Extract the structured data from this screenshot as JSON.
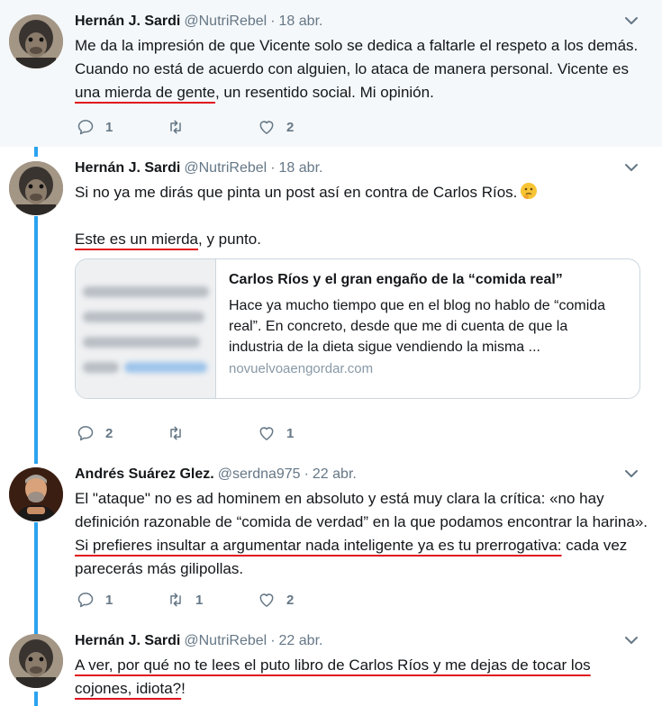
{
  "tweets": [
    {
      "name": "Hernán J. Sardi",
      "handle": "@NutriRebel",
      "date": "18 abr.",
      "text": {
        "p1": "Me da la impresión de que Vicente solo se dedica a faltarle el respeto a los demás. Cuando no está de acuerdo con alguien, lo ataca de manera personal. Vicente es ",
        "u1": "una mierda de gente",
        "p2": ", un resentido social. Mi opinión."
      },
      "actions": {
        "replies": "1",
        "retweets": "",
        "likes": "2"
      }
    },
    {
      "name": "Hernán J. Sardi",
      "handle": "@NutriRebel",
      "date": "18 abr.",
      "text": {
        "line1": "Si no ya me dirás que pinta un post así en contra de Carlos Ríos.",
        "emoji": "thinking-face",
        "u1": "Este es un mierda",
        "p2": ", y punto."
      },
      "card": {
        "title": "Carlos Ríos y el gran engaño de la “comida real”",
        "description": "Hace ya mucho tiempo que en el blog no hablo de “comida real”. En concreto, desde que me di cuenta de que la industria de la dieta sigue vendiendo la misma ...",
        "domain": "novuelvoaengordar.com"
      },
      "actions": {
        "replies": "2",
        "retweets": "",
        "likes": "1"
      }
    },
    {
      "name": "Andrés Suárez Glez.",
      "handle": "@serdna975",
      "date": "22 abr.",
      "text": {
        "p1": "El \"ataque\" no es ad hominem en absoluto y está muy clara la crítica: «no hay definición razonable de “comida de verdad” en la que podamos encontrar la harina». ",
        "u1": "Si prefieres insultar a argumentar nada inteligente ya es tu prerrogativa:",
        "p2": " cada vez parecerás más gilipollas."
      },
      "actions": {
        "replies": "1",
        "retweets": "1",
        "likes": "2"
      }
    },
    {
      "name": "Hernán J. Sardi",
      "handle": "@NutriRebel",
      "date": "22 abr.",
      "text": {
        "u1": "A ver, por qué no te lees el puto libro de Carlos Ríos y me dejas de tocar los cojones, idiota?",
        "p2": "!"
      }
    }
  ],
  "colors": {
    "thread_line": "#2aa3ef",
    "underline": "#e0141e",
    "highlight_bg": "#f5f8fa",
    "secondary_text": "#657786"
  },
  "icons": [
    "reply-icon",
    "retweet-icon",
    "like-icon",
    "caret-down-icon",
    "thinking-face-emoji"
  ]
}
